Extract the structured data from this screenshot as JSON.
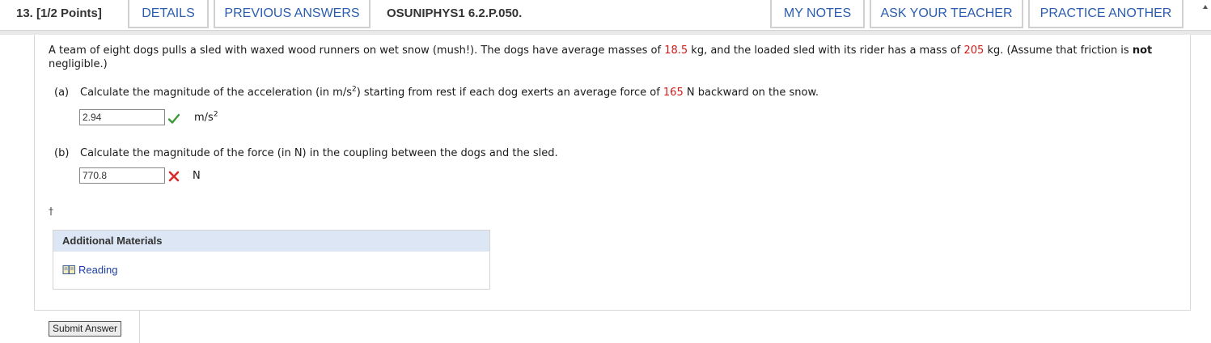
{
  "header": {
    "question_label": "13.  [1/2 Points]",
    "details_label": "DETAILS",
    "previous_answers_label": "PREVIOUS ANSWERS",
    "problem_id": "OSUNIPHYS1 6.2.P.050.",
    "my_notes_label": "MY NOTES",
    "ask_teacher_label": "ASK YOUR TEACHER",
    "practice_another_label": "PRACTICE ANOTHER"
  },
  "problem": {
    "text_1": "A team of eight dogs pulls a sled with waxed wood runners on wet snow (mush!). The dogs have average masses of ",
    "dog_mass": "18.5",
    "text_2": " kg, and the loaded sled with its rider has a mass of ",
    "sled_mass": "205",
    "text_3": " kg. (Assume that friction is ",
    "bold_word": "not",
    "text_4": " negligible.)"
  },
  "part_a": {
    "label": "(a)",
    "text_1": "Calculate the magnitude of the acceleration (in m/s",
    "exp": "2",
    "text_2": ") starting from rest if each dog exerts an average force of ",
    "force": "165",
    "text_3": " N backward on the snow.",
    "answer": "2.94",
    "unit": "m/s",
    "unit_exp": "2",
    "status": "correct"
  },
  "part_b": {
    "label": "(b)",
    "text": "Calculate the magnitude of the force (in N) in the coupling between the dogs and the sled.",
    "answer": "770.8",
    "unit": "N",
    "status": "incorrect"
  },
  "dagger": "†",
  "additional_materials": {
    "title": "Additional Materials",
    "reading_label": "Reading"
  },
  "submit_label": "Submit Answer",
  "colors": {
    "accent": "#2a5db0",
    "highlight": "#d11a1a",
    "correct": "#3a9a3a",
    "incorrect": "#d92b2b",
    "panel_header": "#dde6f5"
  }
}
